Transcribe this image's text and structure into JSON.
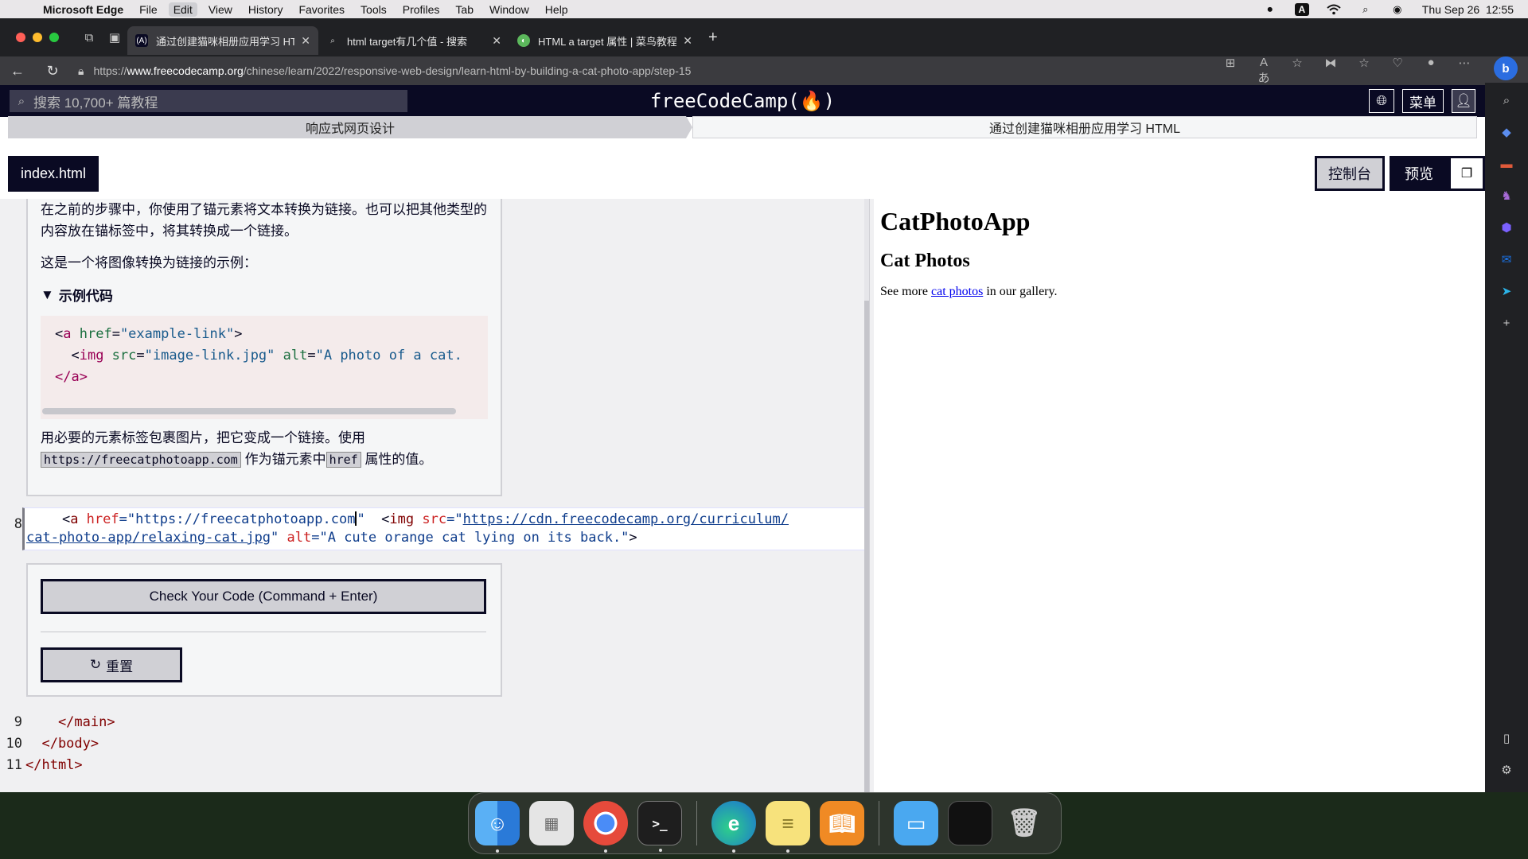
{
  "menubar": {
    "app": "Microsoft Edge",
    "items": [
      "File",
      "Edit",
      "View",
      "History",
      "Favorites",
      "Tools",
      "Profiles",
      "Tab",
      "Window",
      "Help"
    ],
    "active": "Edit",
    "datetime": "Thu Sep 26  12:55"
  },
  "tabs": [
    {
      "title": "通过创建猫咪相册应用学习 HTML",
      "favicon": "(A)",
      "active": true
    },
    {
      "title": "html target有几个值 - 搜索",
      "favicon": "search-icon",
      "active": false
    },
    {
      "title": "HTML a target 属性 | 菜鸟教程",
      "favicon": "runoob-icon",
      "active": false
    }
  ],
  "address": {
    "prefix": "https://",
    "host": "www.freecodecamp.org",
    "path": "/chinese/learn/2022/responsive-web-design/learn-html-by-building-a-cat-photo-app/step-15"
  },
  "fcc": {
    "search_placeholder": "搜索 10,700+ 篇教程",
    "logo": "freeCodeCamp(🔥)",
    "menu_label": "菜单"
  },
  "breadcrumb": {
    "first": "响应式网页设计",
    "second": "通过创建猫咪相册应用学习 HTML"
  },
  "toolbar": {
    "file_tab": "index.html",
    "console": "控制台",
    "preview": "预览"
  },
  "instructions": {
    "p1": "在之前的步骤中，你使用了锚元素将文本转换为链接。也可以把其他类型的内容放在锚标签中，将其转换成一个链接。",
    "p2": "这是一个将图像转换为链接的示例：",
    "details_summary": "示例代码",
    "p3_before": "用必要的元素标签包裹图片，把它变成一个链接。使用",
    "p3_code1": "https://freecatphotoapp.com",
    "p3_middle": "作为锚元素中",
    "p3_code2": "href",
    "p3_after": "属性的值。"
  },
  "example_code": {
    "line1_open": "<",
    "line1_tag": "a",
    "line1_attr": " href",
    "line1_eq": "=",
    "line1_val": "\"example-link\"",
    "line1_close": ">",
    "line2_indent": "  <",
    "line2_tag": "img",
    "line2_attr1": " src",
    "line2_val1": "\"image-link.jpg\"",
    "line2_attr2": " alt",
    "line2_val2": "\"A photo of a cat.",
    "line3": "</a>"
  },
  "editor": {
    "line8_no": "8",
    "line8": {
      "indent": "    <",
      "a_tag": "a",
      "href_attr": " href",
      "href_val_start": "=\"https://freecatphotoapp.com",
      "href_val_end": "\"",
      "space": "  <",
      "img_tag": "img",
      "src_attr": " src",
      "src_eq": "=\"",
      "src_url1": "https://cdn.freecodecamp.org/curriculum/",
      "src_url2": "cat-photo-app/relaxing-cat.jpg",
      "src_close": "\"",
      "alt_attr": " alt",
      "alt_val": "=\"A cute orange cat lying on its back.\"",
      "end": ">"
    },
    "line9_no": "9",
    "line9": "    </main>",
    "line10_no": "10",
    "line10": "  </body>",
    "line11_no": "11",
    "line11": "</html>",
    "check_button": "Check Your Code (Command + Enter)",
    "reset_button": "重置"
  },
  "preview": {
    "h1": "CatPhotoApp",
    "h2": "Cat Photos",
    "text_before": "See more ",
    "link": "cat photos",
    "text_after": " in our gallery."
  },
  "colors": {
    "fcc_dark": "#0a0a23",
    "edge_dark": "#202124",
    "tab_active": "#3b3b3f"
  }
}
